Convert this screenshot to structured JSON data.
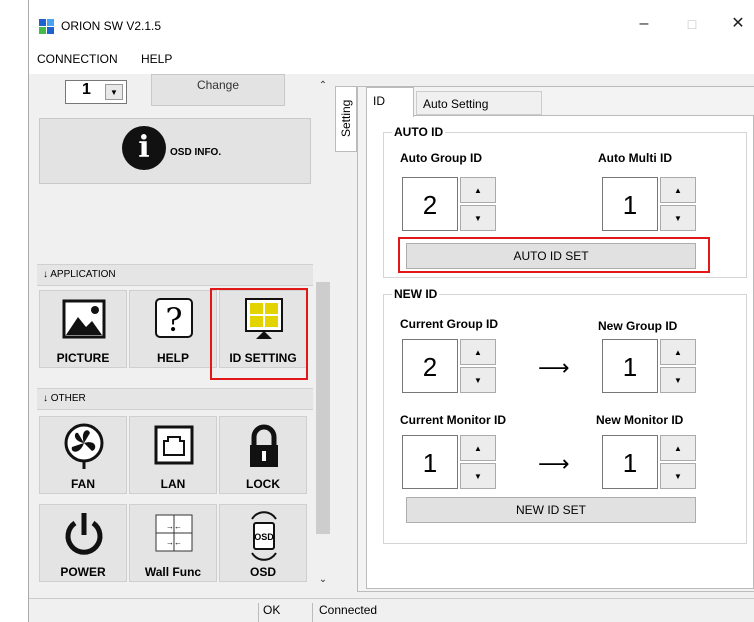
{
  "window": {
    "title": "ORION SW V2.1.5",
    "logo_colors": [
      "#1e62d0",
      "#4aa3ee",
      "#45b94a",
      "#1e62d0"
    ]
  },
  "menu": {
    "items": [
      "CONNECTION",
      "HELP"
    ]
  },
  "left": {
    "selector_value": "1",
    "change_label": "Change",
    "osd_info_label": "OSD INFO.",
    "sections": {
      "application": "APPLICATION",
      "other": "OTHER"
    },
    "application_tiles": [
      "PICTURE",
      "HELP",
      "ID SETTING"
    ],
    "other_tiles": [
      "FAN",
      "LAN",
      "LOCK",
      "POWER",
      "Wall Func",
      "OSD"
    ]
  },
  "vtab": {
    "label": "Setting"
  },
  "tabs": {
    "id": "ID",
    "auto": "Auto Setting"
  },
  "auto_id": {
    "title": "AUTO ID",
    "group_label": "Auto Group ID",
    "group_value": "2",
    "multi_label": "Auto Multi ID",
    "multi_value": "1",
    "button": "AUTO ID SET"
  },
  "new_id": {
    "title": "NEW ID",
    "current_group_label": "Current Group ID",
    "current_group_value": "2",
    "new_group_label": "New Group ID",
    "new_group_value": "1",
    "current_monitor_label": "Current Monitor ID",
    "current_monitor_value": "1",
    "new_monitor_label": "New Monitor ID",
    "new_monitor_value": "1",
    "button": "NEW ID SET"
  },
  "status": {
    "state": "OK",
    "connection": "Connected"
  },
  "colors": {
    "highlight": "#e01818"
  }
}
